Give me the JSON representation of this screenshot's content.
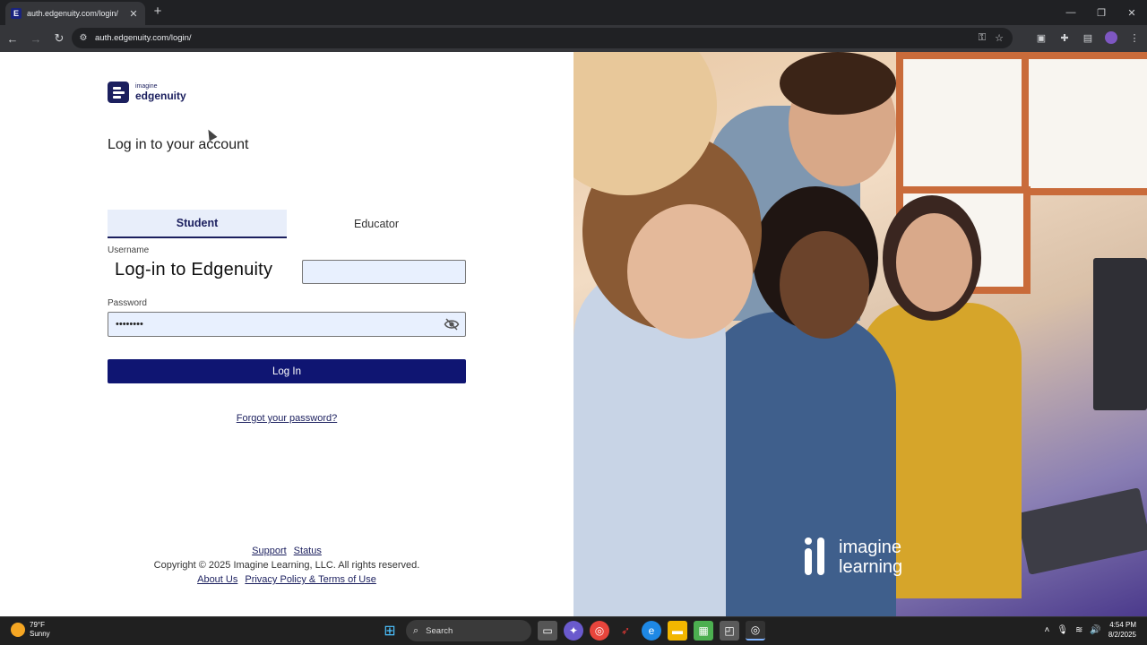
{
  "browser": {
    "tab_title": "auth.edgenuity.com/login/",
    "url": "auth.edgenuity.com/login/"
  },
  "login": {
    "brand_small": "imagine",
    "brand_big": "edgenuity",
    "heading": "Log in to your account",
    "tabs": [
      "Student",
      "Educator"
    ],
    "active_tab": "Student",
    "username_label": "Username",
    "overlay_caption": "Log-in to Edgenuity",
    "username_value": "",
    "password_label": "Password",
    "password_value": "••••••••",
    "login_button": "Log In",
    "forgot_link": "Forgot your password?"
  },
  "footer": {
    "support": "Support",
    "status": "Status",
    "copyright": "Copyright © 2025 Imagine Learning, LLC. All rights reserved.",
    "about": "About Us",
    "privacy": "Privacy Policy & Terms of Use"
  },
  "photo": {
    "logo_line1": "imagine",
    "logo_line2": "learning"
  },
  "taskbar": {
    "temperature": "79°F",
    "condition": "Sunny",
    "search_label": "Search",
    "time": "4:54 PM",
    "date": "8/2/2025"
  },
  "colors": {
    "brand_navy": "#0f1572",
    "tab_active_bg": "#e8eefa",
    "input_bg": "#e8f0fe"
  }
}
